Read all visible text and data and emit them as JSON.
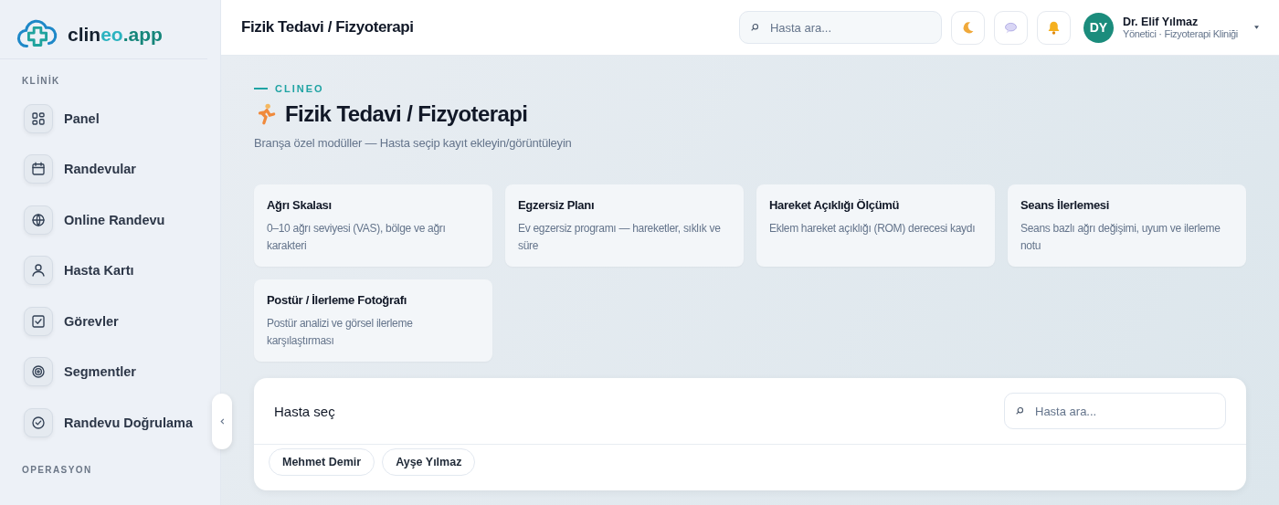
{
  "brand": {
    "name_dark": "clin",
    "name_accent": "eo",
    "name_suffix": ".app"
  },
  "sidebar": {
    "sections": [
      {
        "title": "KLİNİK",
        "items": [
          {
            "label": "Panel",
            "selected": false
          },
          {
            "label": "Randevular",
            "selected": false
          },
          {
            "label": "Online Randevu",
            "selected": false
          },
          {
            "label": "Hasta Kartı",
            "selected": false
          },
          {
            "label": "Görevler",
            "selected": false
          },
          {
            "label": "Segmentler",
            "selected": false
          },
          {
            "label": "Randevu Doğrulama",
            "selected": false
          }
        ]
      },
      {
        "title": "OPERASYON"
      }
    ]
  },
  "header": {
    "title": "Fizik Tedavi / Fizyoterapi",
    "search": {
      "placeholder": "Hasta ara..."
    },
    "user": {
      "initials": "DY",
      "name": "Dr. Elif Yılmaz",
      "role": "Yönetici · Fizyoterapi Kliniği"
    }
  },
  "page": {
    "eyebrow": "CLINEO",
    "title": "Fizik Tedavi / Fizyoterapi",
    "subtitle": "Branşa özel modüller — Hasta seçip kayıt ekleyin/görüntüleyin"
  },
  "modules": [
    {
      "title": "Ağrı Skalası",
      "description": "0–10 ağrı seviyesi (VAS), bölge ve ağrı karakteri"
    },
    {
      "title": "Egzersiz Planı",
      "description": "Ev egzersiz programı — hareketler, sıklık ve süre"
    },
    {
      "title": "Hareket Açıklığı Ölçümü",
      "description": "Eklem hareket açıklığı (ROM) derecesi kaydı"
    },
    {
      "title": "Seans İlerlemesi",
      "description": "Seans bazlı ağrı değişimi, uyum ve ilerleme notu"
    },
    {
      "title": "Postür / İlerleme Fotoğrafı",
      "description": "Postür analizi ve görsel ilerleme karşılaştırması"
    }
  ],
  "patient_picker": {
    "title": "Hasta seç",
    "search": {
      "placeholder": "Hasta ara..."
    },
    "patients": [
      {
        "name": "Mehmet Demir",
        "selected": false
      },
      {
        "name": "Ayşe Yılmaz",
        "selected": false
      }
    ]
  }
}
